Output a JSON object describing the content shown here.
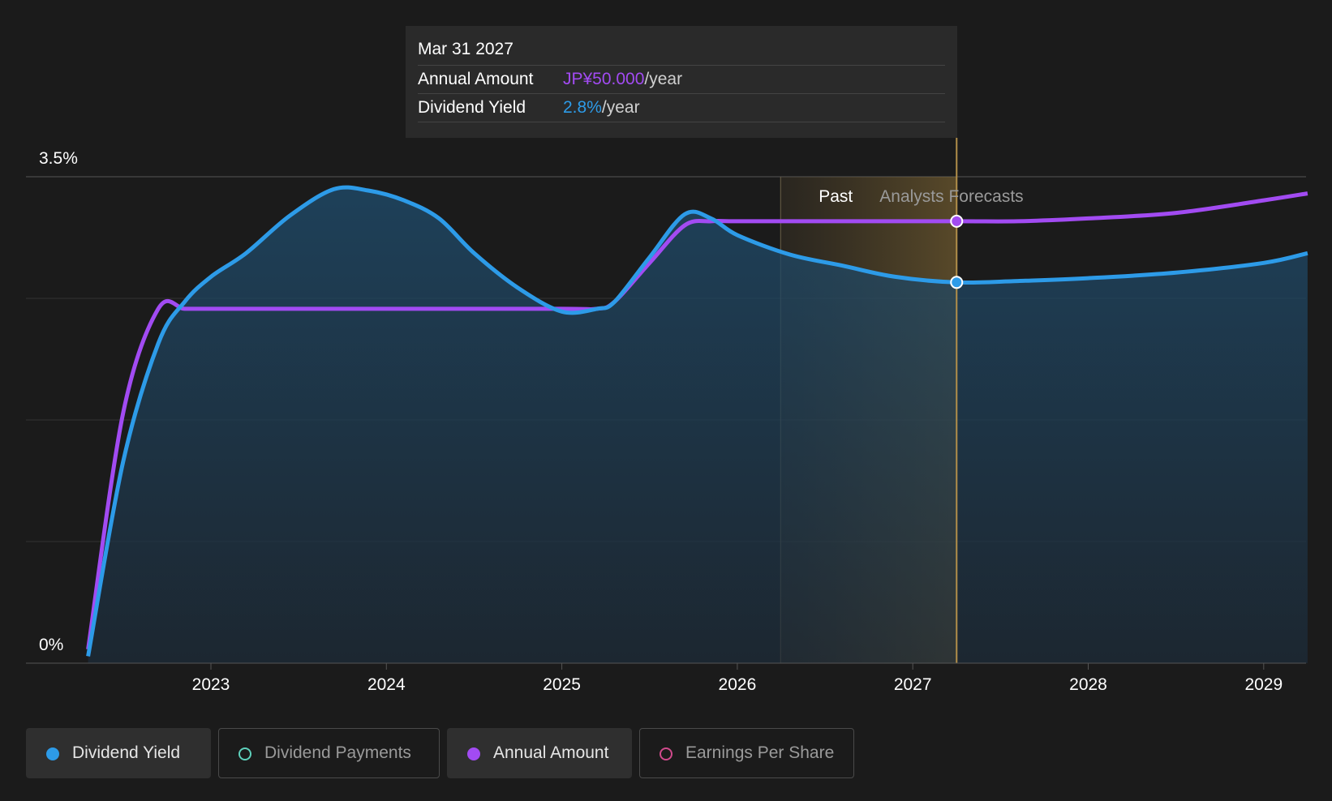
{
  "tooltip": {
    "date": "Mar 31 2027",
    "rows": [
      {
        "label": "Annual Amount",
        "value": "JP¥50.000",
        "unit": "/year",
        "color": "#a24bf2"
      },
      {
        "label": "Dividend Yield",
        "value": "2.8%",
        "unit": "/year",
        "color": "#2d9be8"
      }
    ]
  },
  "legend": [
    {
      "label": "Dividend Yield",
      "color": "#2d9be8",
      "active": true
    },
    {
      "label": "Dividend Payments",
      "color": "#5ed1bc",
      "active": false
    },
    {
      "label": "Annual Amount",
      "color": "#a24bf2",
      "active": true
    },
    {
      "label": "Earnings Per Share",
      "color": "#d04a8c",
      "active": false
    }
  ],
  "chart_data": {
    "type": "area",
    "title": "",
    "xlabel": "",
    "ylabel": "",
    "ylim": [
      0,
      3.5
    ],
    "xlim": [
      2022.3,
      2029.25
    ],
    "x_ticks": [
      "2023",
      "2024",
      "2025",
      "2026",
      "2027",
      "2028",
      "2029"
    ],
    "y_ticks": [
      "0%",
      "3.5%"
    ],
    "gridlines": true,
    "regions": {
      "past_label": "Past",
      "forecast_label": "Analysts Forecasts",
      "divider_x": 2027.25
    },
    "colors": {
      "dividend_yield": "#2d9be8",
      "annual_amount": "#a24bf2"
    },
    "series": [
      {
        "name": "Dividend Yield",
        "unit": "%",
        "x": [
          2022.3,
          2022.5,
          2022.7,
          2022.85,
          2023.0,
          2023.2,
          2023.45,
          2023.7,
          2023.9,
          2024.1,
          2024.3,
          2024.5,
          2024.75,
          2025.0,
          2025.2,
          2025.3,
          2025.5,
          2025.7,
          2025.85,
          2026.0,
          2026.3,
          2026.6,
          2026.9,
          2027.25,
          2027.6,
          2028.0,
          2028.5,
          2029.0,
          2029.25
        ],
        "values": [
          0.05,
          1.45,
          2.3,
          2.6,
          2.78,
          2.95,
          3.22,
          3.41,
          3.4,
          3.33,
          3.2,
          2.95,
          2.7,
          2.53,
          2.55,
          2.6,
          2.92,
          3.23,
          3.2,
          3.08,
          2.94,
          2.86,
          2.78,
          2.74,
          2.75,
          2.77,
          2.81,
          2.88,
          2.95
        ]
      },
      {
        "name": "Annual Amount",
        "unit": "JP¥",
        "x": [
          2022.3,
          2022.5,
          2022.7,
          2022.85,
          2023.0,
          2024.0,
          2025.0,
          2025.2,
          2025.3,
          2025.5,
          2025.7,
          2025.85,
          2026.0,
          2026.5,
          2027.25,
          2027.6,
          2028.0,
          2028.5,
          2029.0,
          2029.25
        ],
        "values": [
          0.1,
          1.8,
          2.55,
          2.55,
          2.55,
          2.55,
          2.55,
          2.55,
          2.6,
          2.88,
          3.15,
          3.18,
          3.18,
          3.18,
          3.18,
          3.18,
          3.2,
          3.24,
          3.33,
          3.38
        ]
      }
    ]
  }
}
